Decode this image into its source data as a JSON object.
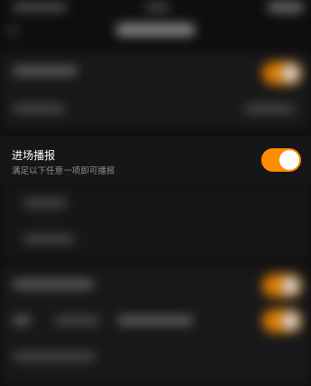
{
  "broadcast_row": {
    "title": "进场播报",
    "subtitle": "满足以下任意一项即可播报",
    "toggle_on": true
  },
  "colors": {
    "accent": "#ff8c00",
    "background": "#0e0e0f"
  }
}
